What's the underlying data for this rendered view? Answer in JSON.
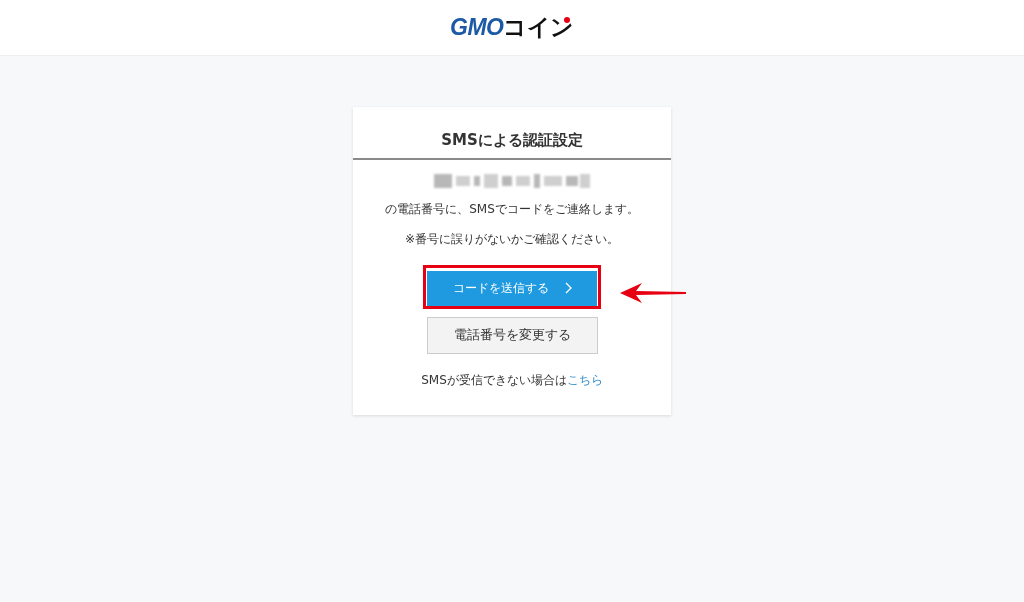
{
  "header": {
    "logo": {
      "brand": "GMO",
      "suffix": "コイン"
    }
  },
  "card": {
    "title": "SMSによる認証設定",
    "messages": [
      "の電話番号に、SMSでコードをご連絡します。",
      "※番号に誤りがないかご確認ください。"
    ],
    "buttons": [
      {
        "kind": "primary",
        "label": "コードを送信する",
        "highlighted": true
      },
      {
        "kind": "secondary",
        "label": "電話番号を変更する",
        "highlighted": false
      }
    ],
    "footer": {
      "text": "SMSが受信できない場合は",
      "link": "こちら"
    }
  }
}
